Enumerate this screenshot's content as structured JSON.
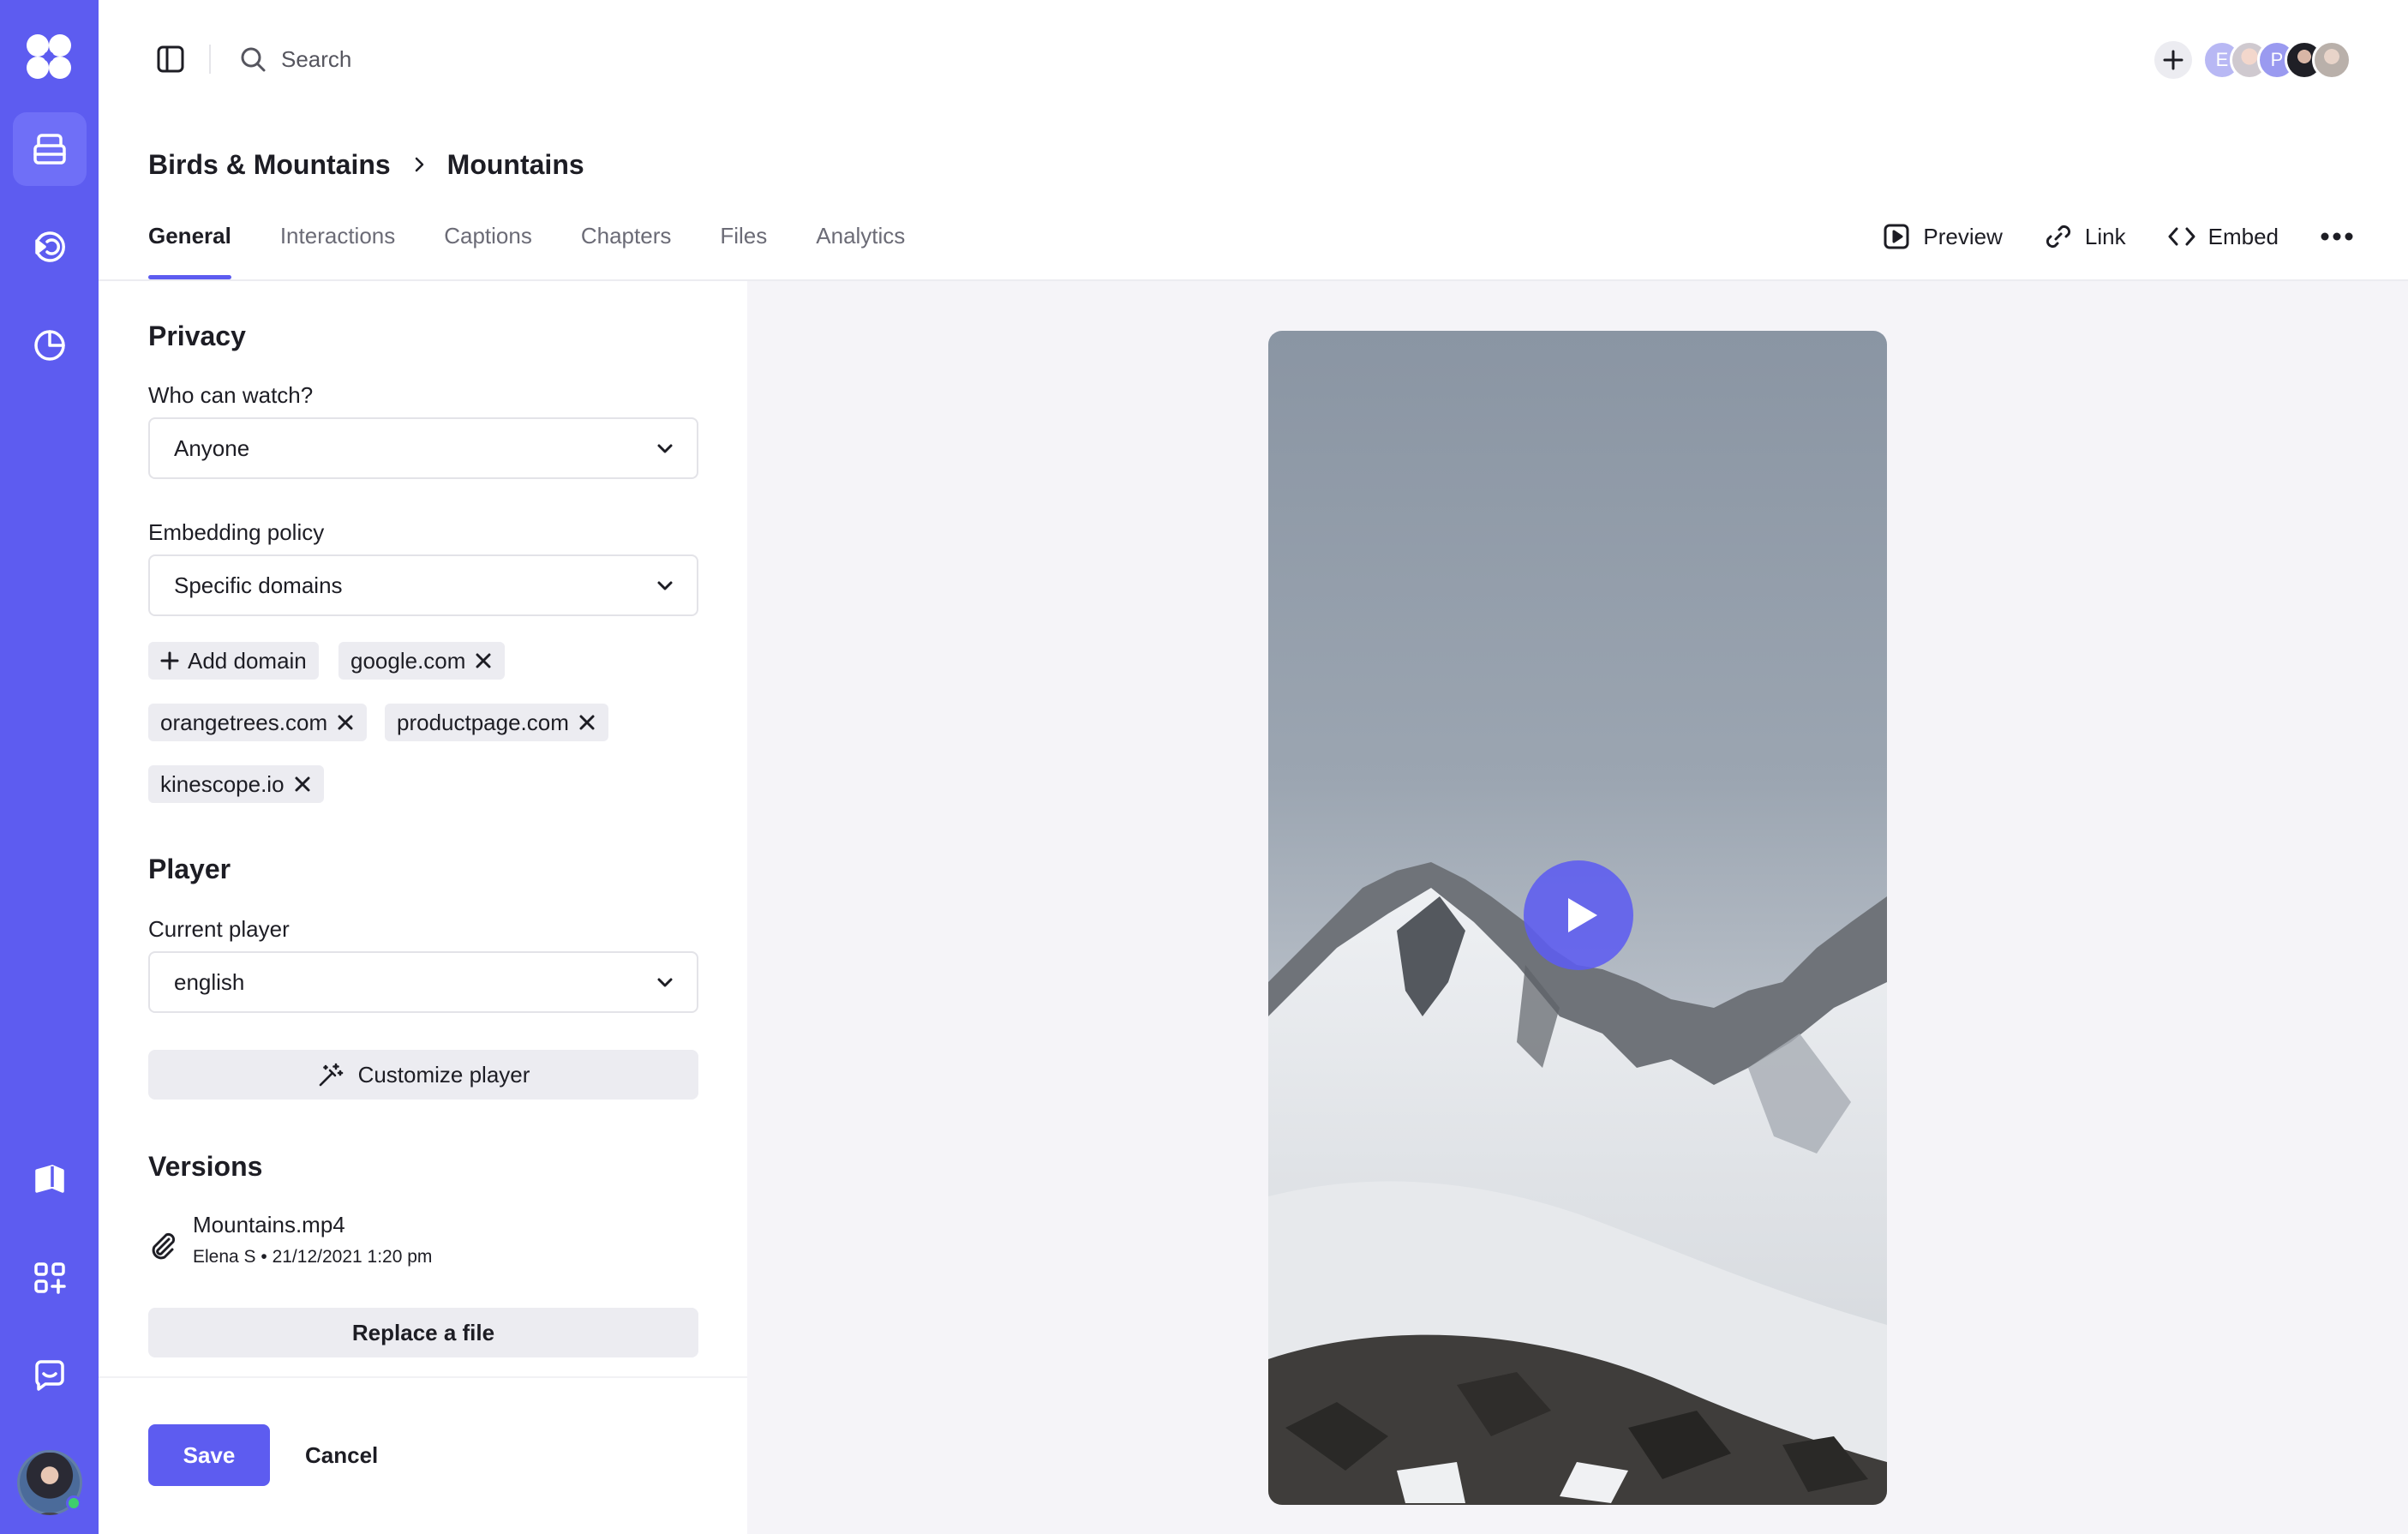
{
  "topbar": {
    "search_placeholder": "Search",
    "avatars": [
      "E",
      "",
      "P",
      "",
      ""
    ]
  },
  "breadcrumb": {
    "parent": "Birds & Mountains",
    "current": "Mountains"
  },
  "tabs": [
    {
      "label": "General",
      "active": true
    },
    {
      "label": "Interactions"
    },
    {
      "label": "Captions"
    },
    {
      "label": "Chapters"
    },
    {
      "label": "Files"
    },
    {
      "label": "Analytics"
    }
  ],
  "actions": {
    "preview": "Preview",
    "link": "Link",
    "embed": "Embed"
  },
  "privacy": {
    "title": "Privacy",
    "who_label": "Who can watch?",
    "who_value": "Anyone",
    "embed_label": "Embedding policy",
    "embed_value": "Specific domains",
    "add_domain": "Add domain",
    "domains": [
      "google.com",
      "orangetrees.com",
      "productpage.com",
      "kinescope.io"
    ]
  },
  "player": {
    "title": "Player",
    "current_label": "Current player",
    "current_value": "english",
    "customize": "Customize player"
  },
  "versions": {
    "title": "Versions",
    "file_name": "Mountains.mp4",
    "file_meta": "Elena S • 21/12/2021 1:20 pm",
    "replace": "Replace a file"
  },
  "footer": {
    "save": "Save",
    "cancel": "Cancel"
  },
  "colors": {
    "accent": "#5d5cf0",
    "sidebar": "#5d5cf0",
    "preview_bg": "#f5f4f8",
    "chip_bg": "#ececf1"
  }
}
